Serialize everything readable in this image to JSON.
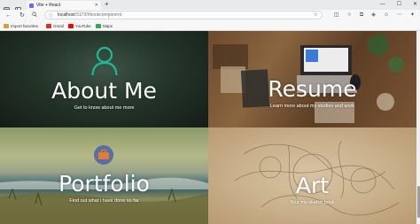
{
  "browser": {
    "tab_title": "Vite + React",
    "tab_favicon_color": "#646cff",
    "url_host": "localhost",
    "url_path": ":5173/#bookcomponent",
    "favorites": [
      {
        "label": "Import favorites",
        "icon": "folder-icon",
        "color": "#d0a23c"
      },
      {
        "label": "Gmail",
        "icon": "gmail-icon",
        "color": "#d93025"
      },
      {
        "label": "YouTube",
        "icon": "youtube-icon",
        "color": "#ff0000"
      },
      {
        "label": "Maps",
        "icon": "maps-icon",
        "color": "#34a853"
      }
    ]
  },
  "tiles": {
    "about": {
      "title": "About Me",
      "subtitle": "Get to know about me more",
      "icon": "user-icon",
      "accent": "#1fb89a"
    },
    "resume": {
      "title": "Resume",
      "subtitle": "Learn more about my studies and work"
    },
    "portfolio": {
      "title": "Portfolio",
      "subtitle": "Find out what i have done so far",
      "icon": "briefcase-icon",
      "accent": "#5a6fa0"
    },
    "art": {
      "title": "Art",
      "subtitle": "Tour my sketch book"
    }
  }
}
